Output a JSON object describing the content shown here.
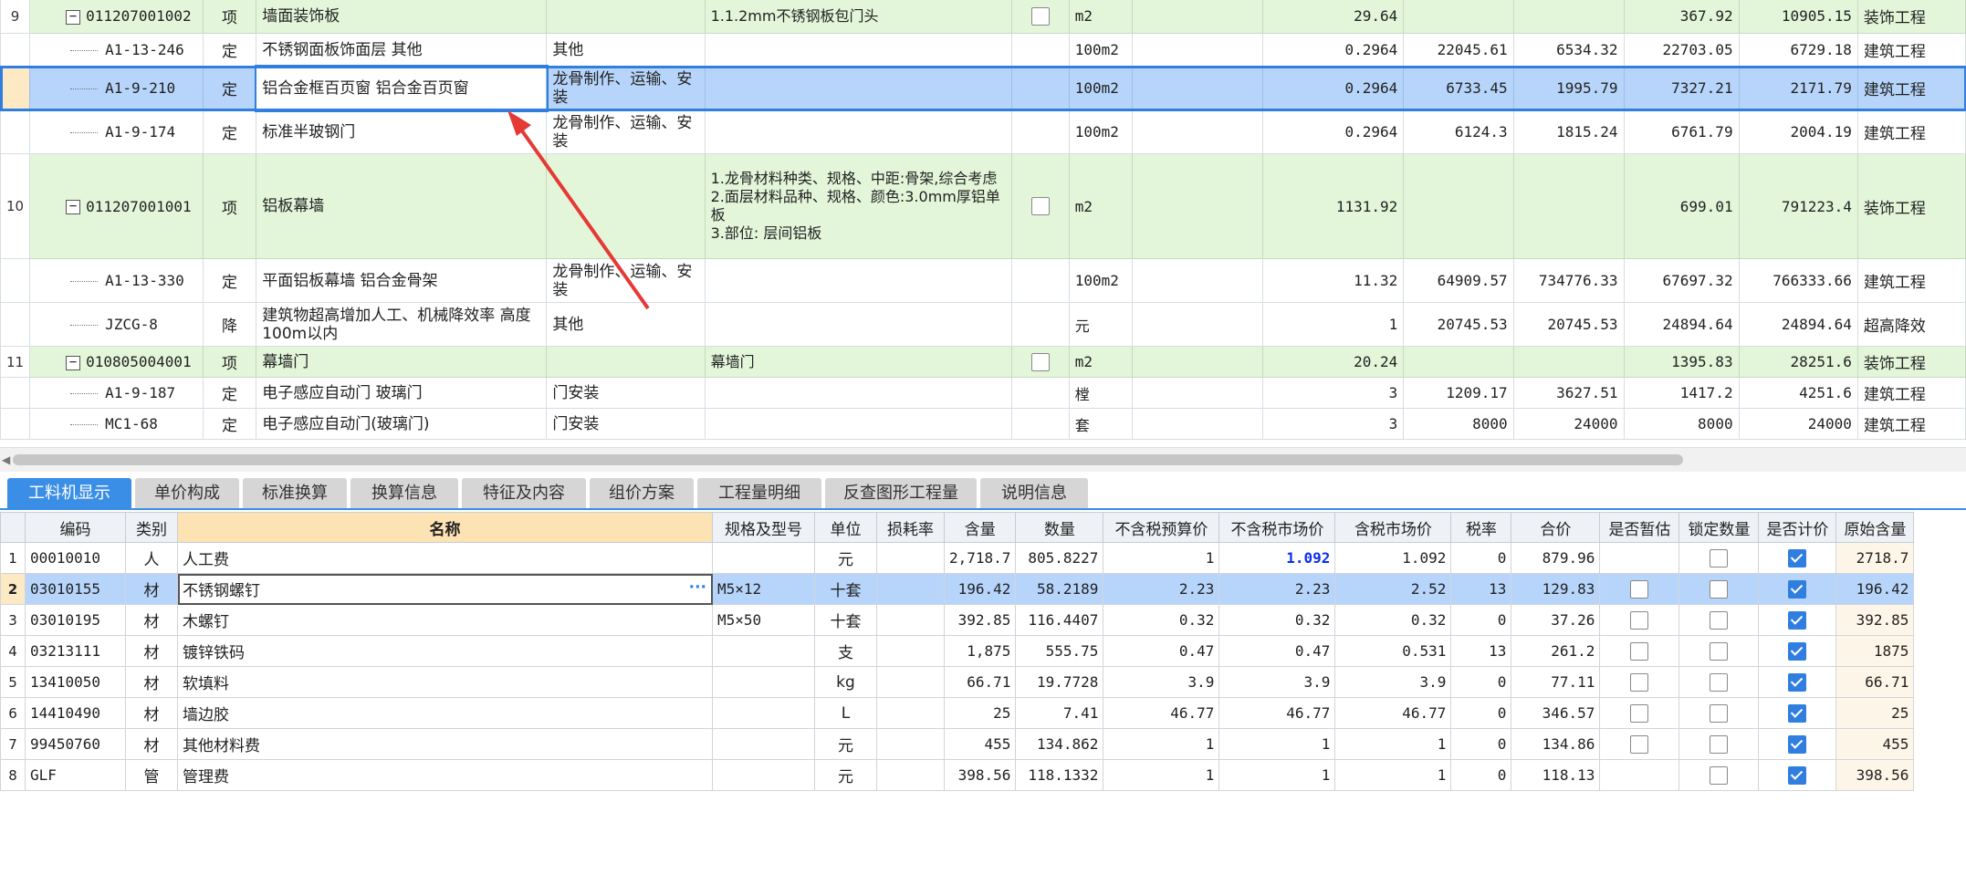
{
  "top_rows": [
    {
      "type": "bill",
      "rownum": "9",
      "code": "011207001002",
      "kind": "项",
      "name": "墙面装饰板",
      "work": "",
      "feature": "1.1.2mm不锈钢板包门头",
      "check": false,
      "unit": "m2",
      "expr": "",
      "qty": "29.64",
      "price": "",
      "labor": "",
      "total_price": "367.92",
      "amount": "10905.15",
      "major": "装饰工程"
    },
    {
      "type": "quota",
      "rownum": "",
      "code": "A1-13-246",
      "kind": "定",
      "name": "不锈钢面板饰面层 其他",
      "work": "其他",
      "feature": "",
      "check": null,
      "unit": "100m2",
      "expr": "",
      "qty": "0.2964",
      "price": "22045.61",
      "labor": "6534.32",
      "total_price": "22703.05",
      "amount": "6729.18",
      "major": "建筑工程"
    },
    {
      "type": "sel",
      "rownum": "",
      "code": "A1-9-210",
      "kind": "定",
      "name": "铝合金框百页窗 铝合金百页窗",
      "work": "龙骨制作、运输、安装",
      "feature": "",
      "check": null,
      "unit": "100m2",
      "expr": "",
      "qty": "0.2964",
      "price": "6733.45",
      "labor": "1995.79",
      "total_price": "7327.21",
      "amount": "2171.79",
      "major": "建筑工程"
    },
    {
      "type": "quota",
      "rownum": "",
      "code": "A1-9-174",
      "kind": "定",
      "name": "标准半玻钢门",
      "work": "龙骨制作、运输、安装",
      "feature": "",
      "check": null,
      "unit": "100m2",
      "expr": "",
      "qty": "0.2964",
      "price": "6124.3",
      "labor": "1815.24",
      "total_price": "6761.79",
      "amount": "2004.19",
      "major": "建筑工程"
    },
    {
      "type": "bill",
      "rownum": "10",
      "code": "011207001001",
      "kind": "项",
      "name": "铝板幕墙",
      "work": "",
      "feature": "1.龙骨材料种类、规格、中距:骨架,综合考虑\n2.面层材料品种、规格、颜色:3.0mm厚铝单板\n3.部位: 层间铝板",
      "check": false,
      "unit": "m2",
      "expr": "",
      "qty": "1131.92",
      "price": "",
      "labor": "",
      "total_price": "699.01",
      "amount": "791223.4",
      "major": "装饰工程"
    },
    {
      "type": "quota",
      "rownum": "",
      "code": "A1-13-330",
      "kind": "定",
      "name": "平面铝板幕墙 铝合金骨架",
      "work": "龙骨制作、运输、安装",
      "feature": "",
      "check": null,
      "unit": "100m2",
      "expr": "",
      "qty": "11.32",
      "price": "64909.57",
      "labor": "734776.33",
      "total_price": "67697.32",
      "amount": "766333.66",
      "major": "建筑工程"
    },
    {
      "type": "quota",
      "rownum": "",
      "code": "JZCG-8",
      "kind": "降",
      "name": "建筑物超高增加人工、机械降效率 高度100m以内",
      "work": "其他",
      "feature": "",
      "check": null,
      "unit": "元",
      "expr": "",
      "qty": "1",
      "price": "20745.53",
      "labor": "20745.53",
      "total_price": "24894.64",
      "amount": "24894.64",
      "major": "超高降效"
    },
    {
      "type": "bill",
      "rownum": "11",
      "code": "010805004001",
      "kind": "项",
      "name": "幕墙门",
      "work": "",
      "feature": "幕墙门",
      "check": false,
      "unit": "m2",
      "expr": "",
      "qty": "20.24",
      "price": "",
      "labor": "",
      "total_price": "1395.83",
      "amount": "28251.6",
      "major": "装饰工程"
    },
    {
      "type": "quota",
      "rownum": "",
      "code": "A1-9-187",
      "kind": "定",
      "name": "电子感应自动门 玻璃门",
      "work": "门安装",
      "feature": "",
      "check": null,
      "unit": "樘",
      "expr": "",
      "qty": "3",
      "price": "1209.17",
      "labor": "3627.51",
      "total_price": "1417.2",
      "amount": "4251.6",
      "major": "建筑工程"
    },
    {
      "type": "quota",
      "rownum": "",
      "code": "MC1-68",
      "kind": "定",
      "name": "电子感应自动门(玻璃门)",
      "work": "门安装",
      "feature": "",
      "check": null,
      "unit": "套",
      "expr": "",
      "qty": "3",
      "price": "8000",
      "labor": "24000",
      "total_price": "8000",
      "amount": "24000",
      "major": "建筑工程"
    }
  ],
  "tabs": [
    "工料机显示",
    "单价构成",
    "标准换算",
    "换算信息",
    "特征及内容",
    "组价方案",
    "工程量明细",
    "反查图形工程量",
    "说明信息"
  ],
  "bottom_headers": [
    "编码",
    "类别",
    "名称",
    "规格及型号",
    "单位",
    "损耗率",
    "含量",
    "数量",
    "不含税预算价",
    "不含税市场价",
    "含税市场价",
    "税率",
    "合价",
    "是否暂估",
    "锁定数量",
    "是否计价",
    "原始含量"
  ],
  "bottom_rows": [
    {
      "n": "1",
      "code": "00010010",
      "cat": "人",
      "name": "人工费",
      "spec": "",
      "unit": "元",
      "loss": "",
      "content": "2,718.7",
      "qty": "805.8227",
      "budget": "1",
      "market": "1.092",
      "market_tax": "1.092",
      "tax": "0",
      "total": "879.96",
      "est": null,
      "lock": false,
      "priced": true,
      "orig": "2718.7"
    },
    {
      "n": "2",
      "code": "03010155",
      "cat": "材",
      "name": "不锈钢螺钉",
      "spec": "M5×12",
      "unit": "十套",
      "loss": "",
      "content": "196.42",
      "qty": "58.2189",
      "budget": "2.23",
      "market": "2.23",
      "market_tax": "2.52",
      "tax": "13",
      "total": "129.83",
      "est": false,
      "lock": false,
      "priced": true,
      "orig": "196.42"
    },
    {
      "n": "3",
      "code": "03010195",
      "cat": "材",
      "name": "木螺钉",
      "spec": "M5×50",
      "unit": "十套",
      "loss": "",
      "content": "392.85",
      "qty": "116.4407",
      "budget": "0.32",
      "market": "0.32",
      "market_tax": "0.32",
      "tax": "0",
      "total": "37.26",
      "est": false,
      "lock": false,
      "priced": true,
      "orig": "392.85"
    },
    {
      "n": "4",
      "code": "03213111",
      "cat": "材",
      "name": "镀锌铁码",
      "spec": "",
      "unit": "支",
      "loss": "",
      "content": "1,875",
      "qty": "555.75",
      "budget": "0.47",
      "market": "0.47",
      "market_tax": "0.531",
      "tax": "13",
      "total": "261.2",
      "est": false,
      "lock": false,
      "priced": true,
      "orig": "1875"
    },
    {
      "n": "5",
      "code": "13410050",
      "cat": "材",
      "name": "软填料",
      "spec": "",
      "unit": "kg",
      "loss": "",
      "content": "66.71",
      "qty": "19.7728",
      "budget": "3.9",
      "market": "3.9",
      "market_tax": "3.9",
      "tax": "0",
      "total": "77.11",
      "est": false,
      "lock": false,
      "priced": true,
      "orig": "66.71"
    },
    {
      "n": "6",
      "code": "14410490",
      "cat": "材",
      "name": "墙边胶",
      "spec": "",
      "unit": "L",
      "loss": "",
      "content": "25",
      "qty": "7.41",
      "budget": "46.77",
      "market": "46.77",
      "market_tax": "46.77",
      "tax": "0",
      "total": "346.57",
      "est": false,
      "lock": false,
      "priced": true,
      "orig": "25"
    },
    {
      "n": "7",
      "code": "99450760",
      "cat": "材",
      "name": "其他材料费",
      "spec": "",
      "unit": "元",
      "loss": "",
      "content": "455",
      "qty": "134.862",
      "budget": "1",
      "market": "1",
      "market_tax": "1",
      "tax": "0",
      "total": "134.86",
      "est": false,
      "lock": false,
      "priced": true,
      "orig": "455"
    },
    {
      "n": "8",
      "code": "GLF",
      "cat": "管",
      "name": "管理费",
      "spec": "",
      "unit": "元",
      "loss": "",
      "content": "398.56",
      "qty": "118.1332",
      "budget": "1",
      "market": "1",
      "market_tax": "1",
      "tax": "0",
      "total": "118.13",
      "est": null,
      "lock": false,
      "priced": true,
      "orig": "398.56"
    }
  ],
  "edit_ellipsis": "···",
  "colors": {
    "accent": "#3a8ee6",
    "bill_row": "#e3f6da",
    "selected_row": "#b7d5fb",
    "annotation_arrow": "#e53935"
  }
}
